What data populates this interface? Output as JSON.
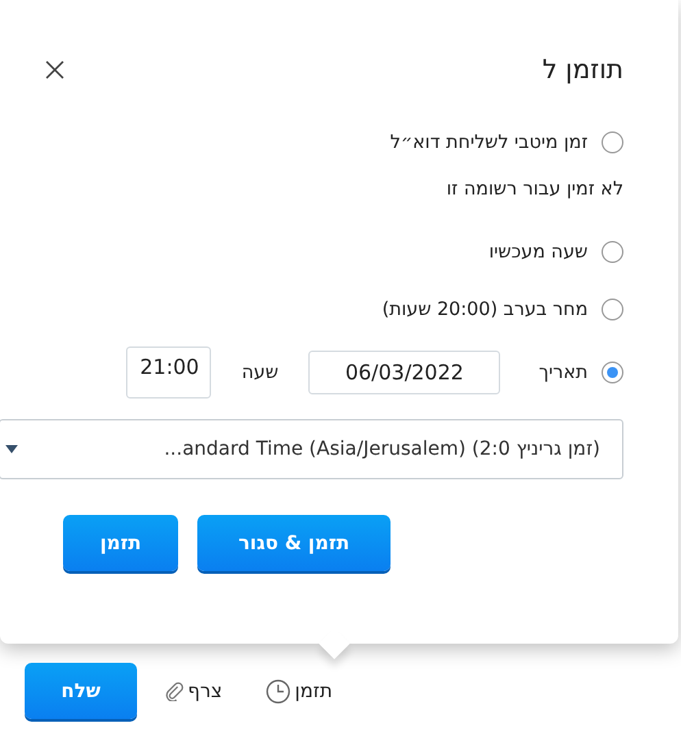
{
  "dialog": {
    "title": "תוזמן ל",
    "options": [
      {
        "kind": "radio",
        "label": "זמן מיטבי לשליחת דוא״ל",
        "selected": false
      },
      {
        "kind": "note",
        "label": "לא זמין עבור רשומה זו"
      },
      {
        "kind": "radio",
        "label": "שעה מעכשיו",
        "selected": false
      },
      {
        "kind": "radio",
        "label": "מחר בערב (20:00 שעות)",
        "selected": false
      },
      {
        "kind": "datetime",
        "label": "תאריך",
        "selected": true,
        "date": "06/03/2022",
        "time_label": "שעה",
        "time": "21:00"
      }
    ],
    "timezone": "(זמן גריניץ 2:0) (Asia/Jerusalem) andard Time...",
    "buttons": [
      "תזמן & סגור",
      "תזמן"
    ]
  },
  "toolbar": {
    "schedule": "תזמן",
    "attach": "צרף",
    "send": "שלח"
  }
}
